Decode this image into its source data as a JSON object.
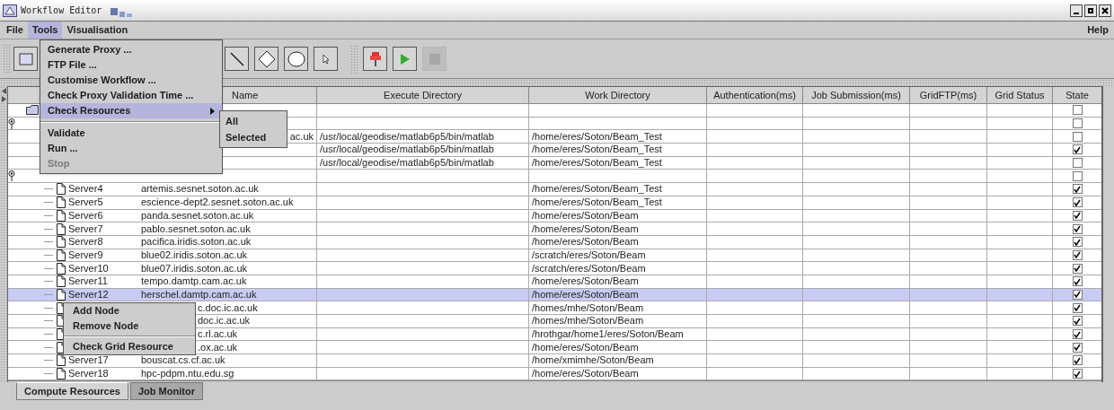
{
  "window": {
    "title": "Workflow Editor"
  },
  "menu_bar": {
    "items": [
      {
        "label": "File",
        "selected": false
      },
      {
        "label": "Tools",
        "selected": true
      },
      {
        "label": "Visualisation",
        "selected": false
      }
    ],
    "help": "Help"
  },
  "toolbar": [
    {
      "kind": "rect",
      "disabled": false
    },
    {
      "kind": "line",
      "disabled": false
    },
    {
      "kind": "diamond",
      "disabled": false
    },
    {
      "kind": "circle",
      "disabled": false
    },
    {
      "kind": "pointer",
      "disabled": false
    },
    {
      "kind": "pin",
      "disabled": false
    },
    {
      "kind": "play",
      "disabled": false
    },
    {
      "kind": "stop",
      "disabled": true
    }
  ],
  "tools_menu": {
    "items": [
      {
        "kind": "item",
        "label": "Generate Proxy ...",
        "selected": false,
        "disabled": false
      },
      {
        "kind": "item",
        "label": "FTP File ...",
        "selected": false,
        "disabled": false
      },
      {
        "kind": "item",
        "label": "Customise Workflow ...",
        "selected": false,
        "disabled": false
      },
      {
        "kind": "item",
        "label": "Check Proxy Validation Time ...",
        "selected": false,
        "disabled": false
      },
      {
        "kind": "submenu",
        "label": "Check Resources",
        "selected": true,
        "disabled": false
      },
      {
        "kind": "separator"
      },
      {
        "kind": "item",
        "label": "Validate",
        "selected": false,
        "disabled": false
      },
      {
        "kind": "item",
        "label": "Run ...",
        "selected": false,
        "disabled": false
      },
      {
        "kind": "item",
        "label": "Stop",
        "selected": false,
        "disabled": true
      }
    ]
  },
  "submenu": {
    "items": [
      {
        "label": "All"
      },
      {
        "label": "Selected"
      }
    ]
  },
  "table": {
    "columns": [
      "Name",
      "Execute Directory",
      "Work Directory",
      "Authentication(ms)",
      "Job Submission(ms)",
      "GridFTP(ms)",
      "Grid Status",
      "State"
    ],
    "rows": [
      {
        "kind": "folder",
        "checked": false,
        "selected": false
      },
      {
        "kind": "group",
        "checked": false,
        "selected": false
      },
      {
        "kind": "partial",
        "name": "ac.uk",
        "execute_directory": "/usr/local/geodise/matlab6p5/bin/matlab",
        "work_directory": "/home/eres/Soton/Beam_Test",
        "checked": false,
        "selected": false
      },
      {
        "kind": "server",
        "execute_directory": "/usr/local/geodise/matlab6p5/bin/matlab",
        "work_directory": "/home/eres/Soton/Beam_Test",
        "checked": true,
        "selected": false
      },
      {
        "kind": "server",
        "execute_directory": "/usr/local/geodise/matlab6p5/bin/matlab",
        "work_directory": "/home/eres/Soton/Beam_Test",
        "checked": false,
        "selected": false
      },
      {
        "kind": "group",
        "checked": false,
        "selected": false
      },
      {
        "kind": "server",
        "label": "Server4",
        "name": "artemis.sesnet.soton.ac.uk",
        "work_directory": "/home/eres/Soton/Beam_Test",
        "checked": true,
        "selected": false
      },
      {
        "kind": "server",
        "label": "Server5",
        "name": "escience-dept2.sesnet.soton.ac.uk",
        "work_directory": "/home/eres/Soton/Beam_Test",
        "checked": true,
        "selected": false
      },
      {
        "kind": "server",
        "label": "Server6",
        "name": "panda.sesnet.soton.ac.uk",
        "work_directory": "/home/eres/Soton/Beam",
        "checked": true,
        "selected": false
      },
      {
        "kind": "server",
        "label": "Server7",
        "name": "pablo.sesnet.soton.ac.uk",
        "work_directory": "/home/eres/Soton/Beam",
        "checked": true,
        "selected": false
      },
      {
        "kind": "server",
        "label": "Server8",
        "name": "pacifica.iridis.soton.ac.uk",
        "work_directory": "/home/eres/Soton/Beam",
        "checked": true,
        "selected": false
      },
      {
        "kind": "server",
        "label": "Server9",
        "name": "blue02.iridis.soton.ac.uk",
        "work_directory": "/scratch/eres/Soton/Beam",
        "checked": true,
        "selected": false
      },
      {
        "kind": "server",
        "label": "Server10",
        "name": "blue07.iridis.soton.ac.uk",
        "work_directory": "/scratch/eres/Soton/Beam",
        "checked": true,
        "selected": false
      },
      {
        "kind": "server",
        "label": "Server11",
        "name": "tempo.damtp.cam.ac.uk",
        "work_directory": "/home/eres/Soton/Beam",
        "checked": true,
        "selected": false
      },
      {
        "kind": "server",
        "label": "Server12",
        "name": "herschel.damtp.cam.ac.uk",
        "work_directory": "/home/eres/Soton/Beam",
        "checked": true,
        "selected": true
      },
      {
        "kind": "covered",
        "name": "c.doc.ic.ac.uk",
        "work_directory": "/homes/mhe/Soton/Beam",
        "checked": true,
        "selected": false
      },
      {
        "kind": "covered",
        "name": "doc.ic.ac.uk",
        "work_directory": "/homes/mhe/Soton/Beam",
        "checked": true,
        "selected": false
      },
      {
        "kind": "covered",
        "name": "c.rl.ac.uk",
        "work_directory": "/hrothgar/home1/eres/Soton/Beam",
        "checked": true,
        "selected": false
      },
      {
        "kind": "covered",
        "name": ".ox.ac.uk",
        "work_directory": "/home/eres/Soton/Beam",
        "checked": true,
        "selected": false
      },
      {
        "kind": "server",
        "label": "Server17",
        "name": "bouscat.cs.cf.ac.uk",
        "work_directory": "/home/xmimhe/Soton/Beam",
        "checked": true,
        "selected": false
      },
      {
        "kind": "server",
        "label": "Server18",
        "name": "hpc-pdpm.ntu.edu.sg",
        "work_directory": "/home/eres/Soton/Beam",
        "checked": true,
        "selected": false
      }
    ]
  },
  "context_menu": {
    "items": [
      {
        "kind": "item",
        "label": "Add Node"
      },
      {
        "kind": "item",
        "label": "Remove Node"
      },
      {
        "kind": "separator"
      },
      {
        "kind": "item",
        "label": "Check Grid Resource"
      }
    ]
  },
  "tabs": [
    {
      "label": "Compute Resources",
      "selected": true
    },
    {
      "label": "Job Monitor",
      "selected": false
    }
  ]
}
